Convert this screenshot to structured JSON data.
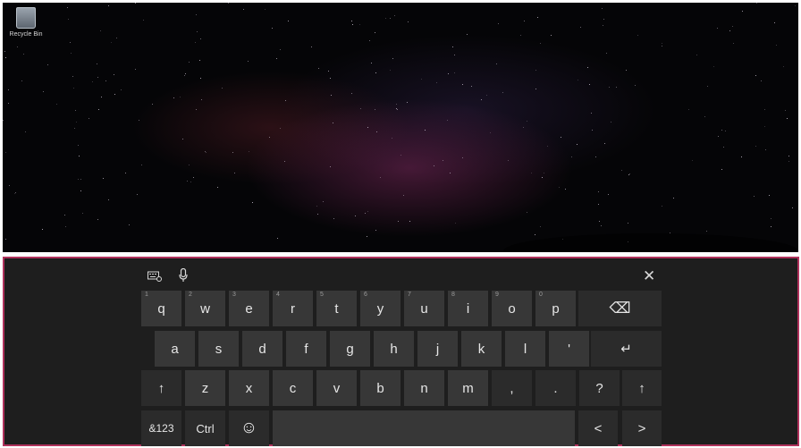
{
  "desktop": {
    "recycle_bin_label": "Recycle Bin"
  },
  "keyboard": {
    "toolbar": {
      "close_glyph": "✕"
    },
    "row1": [
      {
        "num": "1",
        "label": "q"
      },
      {
        "num": "2",
        "label": "w"
      },
      {
        "num": "3",
        "label": "e"
      },
      {
        "num": "4",
        "label": "r"
      },
      {
        "num": "5",
        "label": "t"
      },
      {
        "num": "6",
        "label": "y"
      },
      {
        "num": "7",
        "label": "u"
      },
      {
        "num": "8",
        "label": "i"
      },
      {
        "num": "9",
        "label": "o"
      },
      {
        "num": "0",
        "label": "p"
      }
    ],
    "backspace_glyph": "⌫",
    "row2": [
      "a",
      "s",
      "d",
      "f",
      "g",
      "h",
      "j",
      "k",
      "l",
      "'"
    ],
    "enter_glyph": "↵",
    "row3": [
      "z",
      "x",
      "c",
      "v",
      "b",
      "n",
      "m",
      ",",
      ".",
      "?"
    ],
    "shift_glyph": "↑",
    "symbols_label": "&123",
    "ctrl_label": "Ctrl",
    "emoji_glyph": "☺",
    "left_glyph": "<",
    "right_glyph": ">"
  }
}
